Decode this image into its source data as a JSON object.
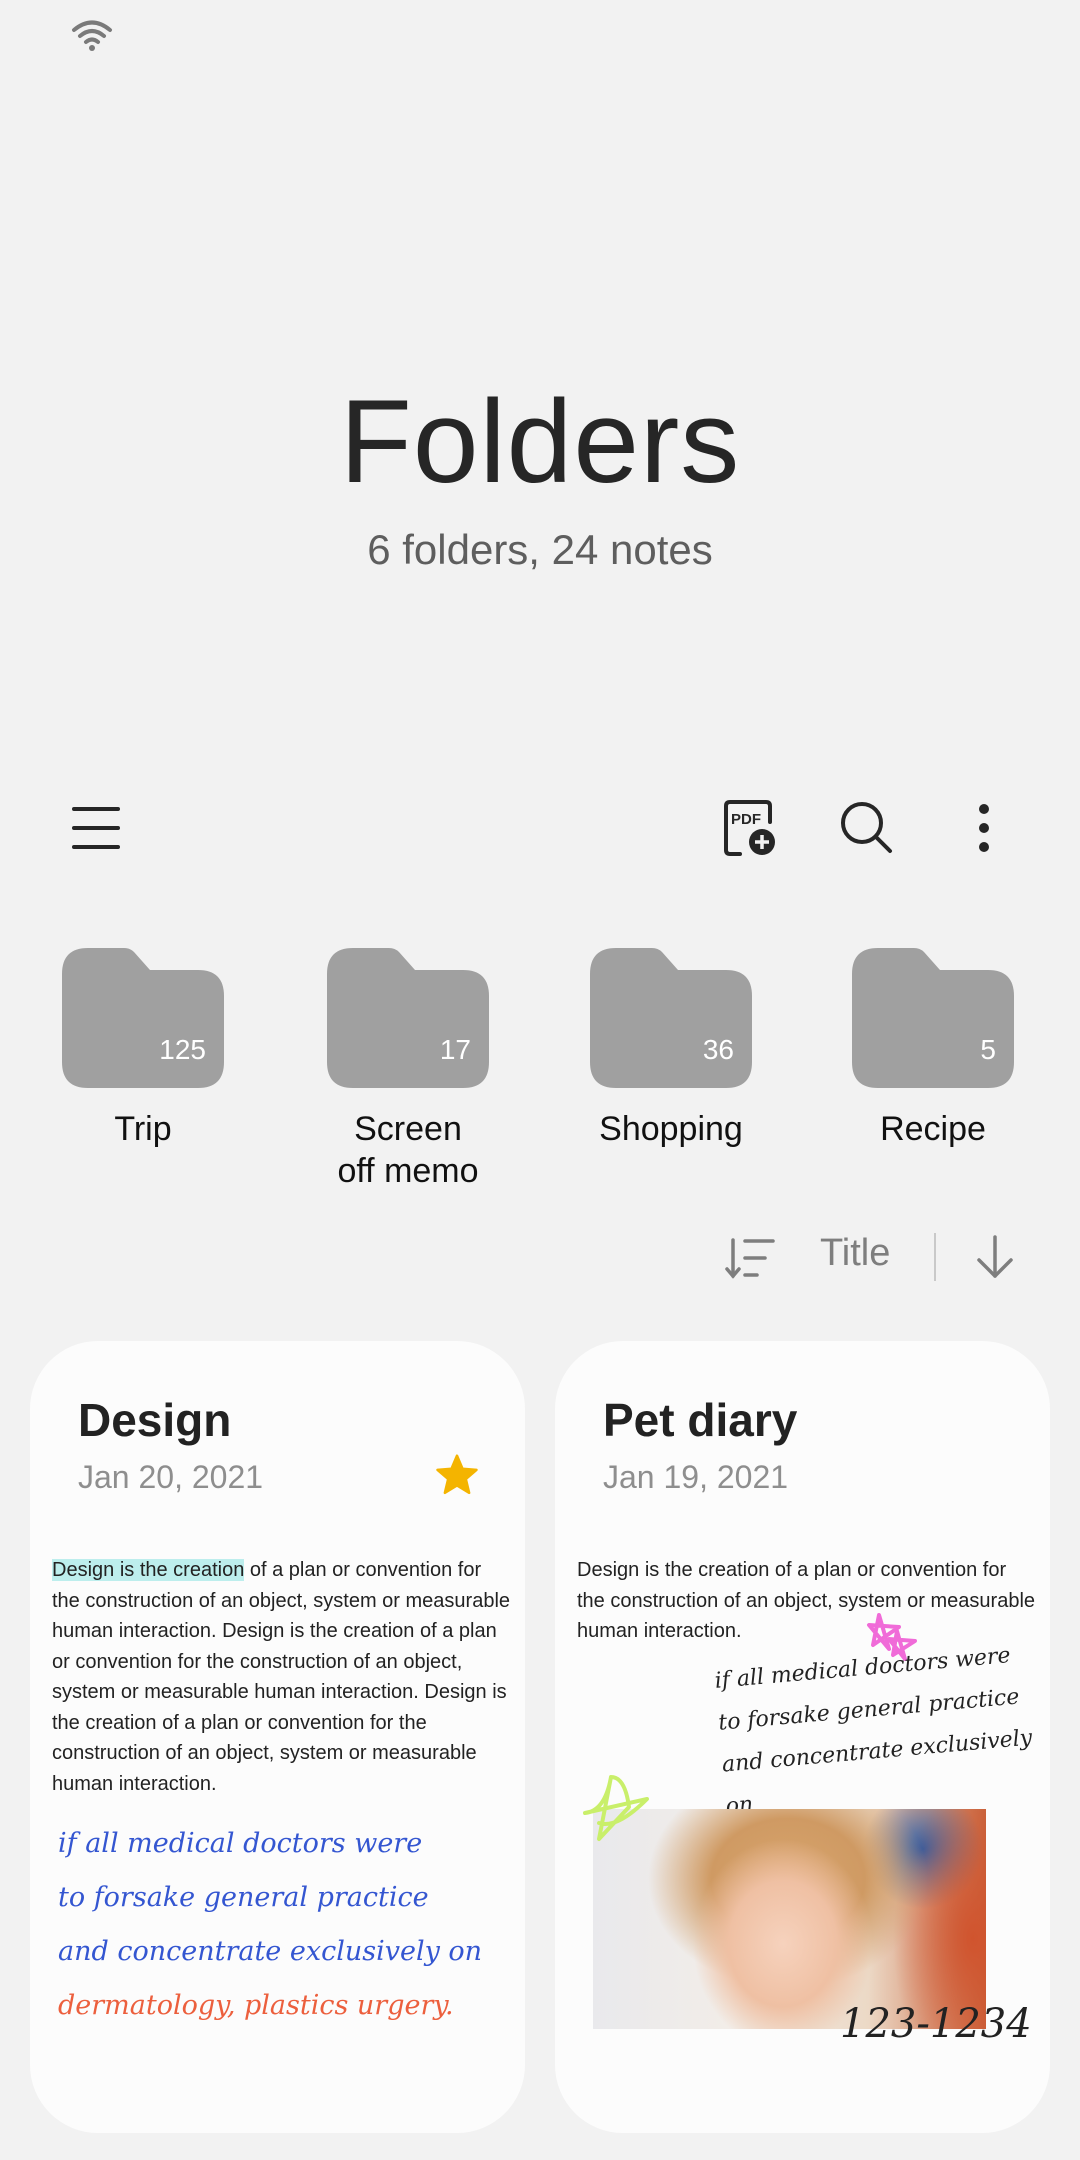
{
  "status_bar": {
    "wifi_icon": "wifi-icon"
  },
  "header": {
    "title": "Folders",
    "subtitle": "6 folders, 24 notes"
  },
  "toolbar": {
    "menu_icon": "hamburger-menu-icon",
    "pdf_icon": "import-pdf-icon",
    "pdf_label": "PDF",
    "search_icon": "search-icon",
    "more_icon": "more-options-icon"
  },
  "folders": [
    {
      "name": "Trip",
      "count": "125"
    },
    {
      "name": "Screen off memo",
      "count": "17"
    },
    {
      "name": "Shopping",
      "count": "36"
    },
    {
      "name": "Recipe",
      "count": "5"
    }
  ],
  "folder_color": "#a0a0a0",
  "sort": {
    "sort_icon": "sort-icon",
    "field": "Title",
    "direction_icon": "arrow-down-icon"
  },
  "notes": [
    {
      "title": "Design",
      "date": "Jan 20, 2021",
      "favorite": true,
      "star_color": "#f4b400",
      "highlight": "Design is the creation",
      "body_rest": " of a plan or convention for the construction of an object, system or measurable human interaction. Design is the creation of a plan or convention for the construction of an object, system or measurable human interaction. Design is the creation of a plan or convention for the construction of an object, system or measurable human interaction.",
      "handwriting": [
        {
          "text": "if all medical doctors were",
          "color": "#3456d1"
        },
        {
          "text": "to forsake general practice",
          "color": "#3456d1"
        },
        {
          "text": "and concentrate exclusively on",
          "color": "#3456d1"
        },
        {
          "text": "dermatology, plastics urgery.",
          "color": "#ec5f3d"
        }
      ]
    },
    {
      "title": "Pet diary",
      "date": "Jan 19, 2021",
      "favorite": false,
      "body": "Design is the creation of a plan or convention for the construction of an object, system or measurable human interaction.",
      "handwriting": [
        {
          "text": "if all medical doctors were",
          "color": "#222222"
        },
        {
          "text": "to forsake general practice",
          "color": "#222222"
        },
        {
          "text": "and concentrate exclusively on",
          "color": "#222222"
        }
      ],
      "phone_note": "123-1234",
      "photo_alt": "Smiling curly-haired child"
    }
  ]
}
